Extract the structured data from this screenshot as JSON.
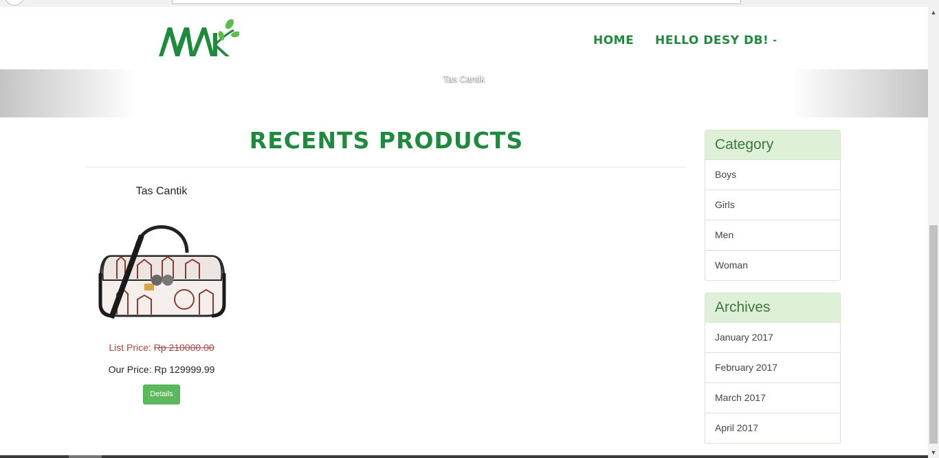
{
  "nav": {
    "home": "HOME",
    "user": "HELLO DESY DB!"
  },
  "banner": {
    "caption": "Tas Cantik"
  },
  "main": {
    "title": "RECENTS PRODUCTS",
    "products": [
      {
        "name": "Tas Cantik",
        "list_price_label": "List Price:",
        "list_price": "Rp 210000.00",
        "our_price": "Our Price: Rp 129999.99",
        "details_label": "Details"
      }
    ]
  },
  "sidebar": {
    "category": {
      "title": "Category",
      "items": [
        "Boys",
        "Girls",
        "Men",
        "Woman"
      ]
    },
    "archives": {
      "title": "Archives",
      "items": [
        "January 2017",
        "February 2017",
        "March 2017",
        "April 2017"
      ]
    }
  },
  "colors": {
    "brand_green": "#1e8a3e",
    "panel_heading_bg": "#dff0d8",
    "button_green": "#5cb85c",
    "list_price_red": "#a94442"
  }
}
